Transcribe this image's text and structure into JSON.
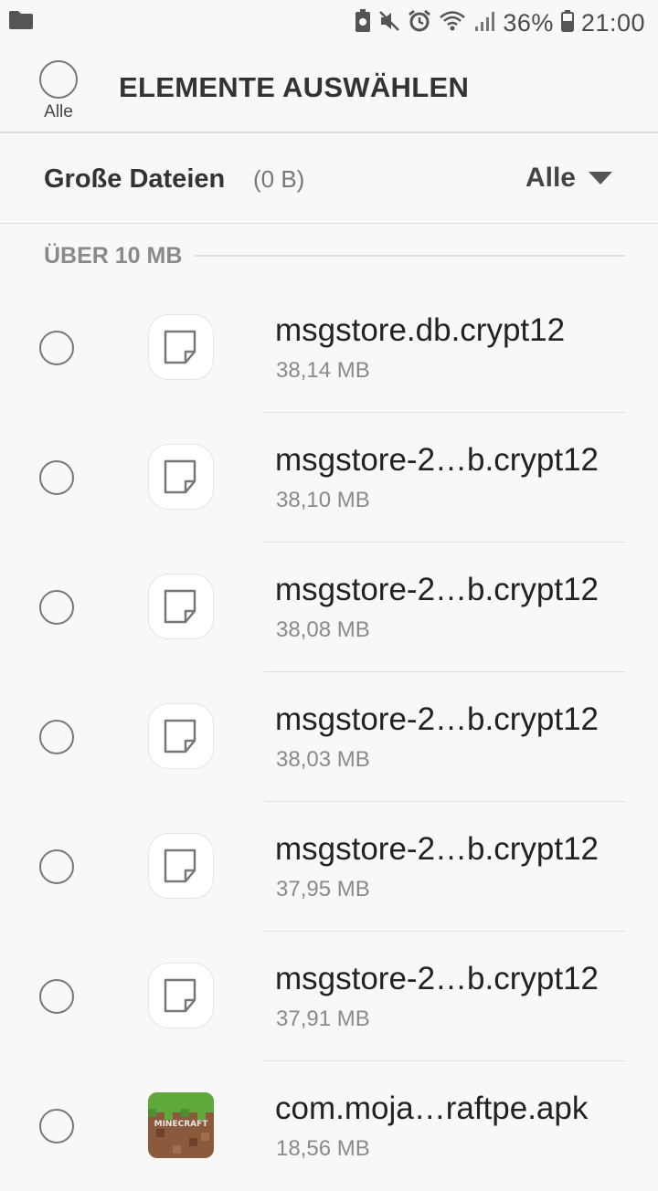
{
  "status_bar": {
    "battery_percent": "36%",
    "time": "21:00",
    "icons": [
      "folder-icon",
      "battery-saver-icon",
      "mute-icon",
      "alarm-icon",
      "wifi-icon",
      "signal-icon",
      "battery-icon"
    ]
  },
  "action_bar": {
    "select_all_label": "Alle",
    "title": "ELEMENTE AUSWÄHLEN"
  },
  "filter": {
    "title": "Große Dateien",
    "total_size": "(0 B)",
    "selected_option": "Alle"
  },
  "section": {
    "title": "ÜBER 10 MB"
  },
  "files": [
    {
      "name": "msgstore.db.crypt12",
      "size": "38,14 MB",
      "icon": "document-icon"
    },
    {
      "name": "msgstore-2…b.crypt12",
      "size": "38,10 MB",
      "icon": "document-icon"
    },
    {
      "name": "msgstore-2…b.crypt12",
      "size": "38,08 MB",
      "icon": "document-icon"
    },
    {
      "name": "msgstore-2…b.crypt12",
      "size": "38,03 MB",
      "icon": "document-icon"
    },
    {
      "name": "msgstore-2…b.crypt12",
      "size": "37,95 MB",
      "icon": "document-icon"
    },
    {
      "name": "msgstore-2…b.crypt12",
      "size": "37,91 MB",
      "icon": "document-icon"
    },
    {
      "name": "com.moja…raftpe.apk",
      "size": "18,56 MB",
      "icon": "minecraft-app-icon",
      "icon_text": "MINECRAFT"
    }
  ],
  "colors": {
    "background": "#f8f8f8",
    "primary_text": "#222222",
    "secondary_text": "#8a8a8a"
  }
}
